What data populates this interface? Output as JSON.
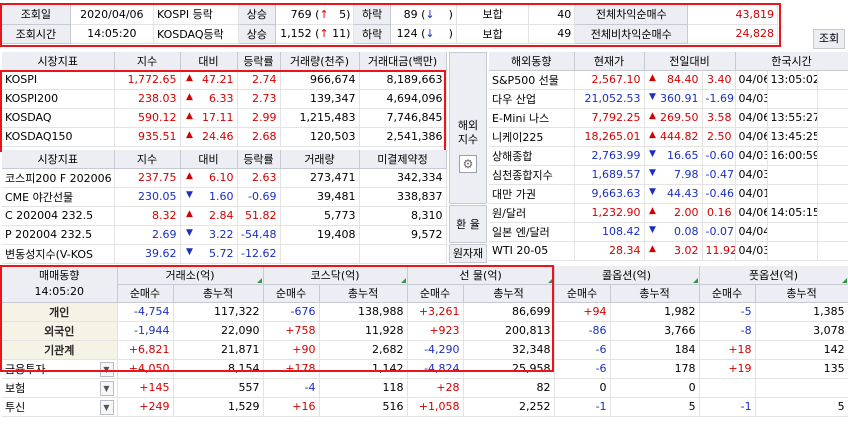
{
  "top": {
    "query_date_label": "조회일",
    "query_date": "2020/04/06",
    "query_time_label": "조회시간",
    "query_time": "14:05:20",
    "rows": [
      {
        "market": "KOSPI 등락",
        "up_label": "상승",
        "up_val": "769",
        "up_arrow": "↑",
        "up_limit": "5",
        "down_label": "하락",
        "down_val": "89",
        "down_arrow": "↓",
        "down_limit": "",
        "flat_label": "보합",
        "flat_val": "40",
        "net_label": "전체차익순매수",
        "net_val": "43,819"
      },
      {
        "market": "KOSDAQ등락",
        "up_label": "상승",
        "up_val": "1,152",
        "up_arrow": "↑",
        "up_limit": "11",
        "down_label": "하락",
        "down_val": "124",
        "down_arrow": "↓",
        "down_limit": "",
        "flat_label": "보합",
        "flat_val": "49",
        "net_label": "전체비차익순매수",
        "net_val": "24,828"
      }
    ],
    "query_button": "조회"
  },
  "index_table": {
    "headers": [
      "시장지표",
      "지수",
      "대비",
      "등락률",
      "거래량(천주)",
      "거래대금(백만)"
    ],
    "rows": [
      {
        "name": "KOSPI",
        "value": "1,772.65",
        "arrow": "▲",
        "change": "47.21",
        "rate": "2.74",
        "volume": "966,674",
        "amount": "8,189,663"
      },
      {
        "name": "KOSPI200",
        "value": "238.03",
        "arrow": "▲",
        "change": "6.33",
        "rate": "2.73",
        "volume": "139,347",
        "amount": "4,694,096"
      },
      {
        "name": "KOSDAQ",
        "value": "590.12",
        "arrow": "▲",
        "change": "17.11",
        "rate": "2.99",
        "volume": "1,215,483",
        "amount": "7,746,845"
      },
      {
        "name": "KOSDAQ150",
        "value": "935.51",
        "arrow": "▲",
        "change": "24.46",
        "rate": "2.68",
        "volume": "120,503",
        "amount": "2,541,386"
      }
    ]
  },
  "deriv_table": {
    "headers": [
      "시장지표",
      "지수",
      "대비",
      "등락률",
      "거래량",
      "미결제약정"
    ],
    "rows": [
      {
        "name": "코스피200 F 202006",
        "value": "237.75",
        "arrow": "▲",
        "change": "6.10",
        "rate": "2.63",
        "volume": "273,471",
        "oi": "342,334",
        "color": "red"
      },
      {
        "name": "CME 야간선물",
        "value": "230.05",
        "arrow": "▼",
        "change": "1.60",
        "rate": "-0.69",
        "volume": "39,481",
        "oi": "338,837",
        "color": "blue"
      },
      {
        "name": "C 202004 232.5",
        "value": "8.32",
        "arrow": "▲",
        "change": "2.84",
        "rate": "51.82",
        "volume": "5,773",
        "oi": "8,310",
        "color": "red"
      },
      {
        "name": "P 202004 232.5",
        "value": "2.69",
        "arrow": "▼",
        "change": "3.22",
        "rate": "-54.48",
        "volume": "19,408",
        "oi": "9,572",
        "color": "blue"
      },
      {
        "name": "변동성지수(V-KOS",
        "value": "39.62",
        "arrow": "▼",
        "change": "5.72",
        "rate": "-12.62",
        "volume": "",
        "oi": "",
        "color": "blue"
      }
    ]
  },
  "overseas": {
    "side_labels": {
      "overseas": "해외\n지수",
      "exchange": "환 율",
      "raw": "원자재"
    },
    "headers": [
      "해외동향",
      "현재가",
      "전일대비",
      "",
      "한국시간"
    ],
    "rows": [
      {
        "name": "S&P500 선물",
        "price": "2,567.10",
        "arrow": "▲",
        "change": "84.40",
        "rate": "3.40",
        "date": "04/06",
        "time": "13:05:02",
        "color": "red"
      },
      {
        "name": "다우 산업",
        "price": "21,052.53",
        "arrow": "▼",
        "change": "360.91",
        "rate": "-1.69",
        "date": "04/03",
        "time": "",
        "color": "blue"
      },
      {
        "name": "E-Mini 나스",
        "price": "7,792.25",
        "arrow": "▲",
        "change": "269.50",
        "rate": "3.58",
        "date": "04/06",
        "time": "13:55:27",
        "color": "red"
      },
      {
        "name": "니케이225",
        "price": "18,265.01",
        "arrow": "▲",
        "change": "444.82",
        "rate": "2.50",
        "date": "04/06",
        "time": "13:45:25",
        "color": "red"
      },
      {
        "name": "상해종합",
        "price": "2,763.99",
        "arrow": "▼",
        "change": "16.65",
        "rate": "-0.60",
        "date": "04/03",
        "time": "16:00:59",
        "color": "blue"
      },
      {
        "name": "심천종합지수",
        "price": "1,689.57",
        "arrow": "▼",
        "change": "7.98",
        "rate": "-0.47",
        "date": "04/03",
        "time": "",
        "color": "blue"
      },
      {
        "name": "대만 가권",
        "price": "9,663.63",
        "arrow": "▼",
        "change": "44.43",
        "rate": "-0.46",
        "date": "04/01",
        "time": "",
        "color": "blue"
      },
      {
        "name": "원/달러",
        "price": "1,232.90",
        "arrow": "▲",
        "change": "2.00",
        "rate": "0.16",
        "date": "04/06",
        "time": "14:05:15",
        "color": "red"
      },
      {
        "name": "일본 엔/달러",
        "price": "108.42",
        "arrow": "▼",
        "change": "0.08",
        "rate": "-0.07",
        "date": "04/04",
        "time": "",
        "color": "blue"
      },
      {
        "name": "WTI 20-05",
        "price": "28.34",
        "arrow": "▲",
        "change": "3.02",
        "rate": "11.92",
        "date": "04/03",
        "time": "",
        "color": "red"
      }
    ]
  },
  "investor": {
    "title": "매매동향",
    "time": "14:05:20",
    "groups": [
      "거래소(억)",
      "코스닥(억)",
      "선 물(억)",
      "콜옵션(억)",
      "풋옵션(억)"
    ],
    "sub": [
      "순매수",
      "총누적"
    ],
    "rows": [
      {
        "name": "개인",
        "dropdown": false,
        "vals": [
          "-4,754",
          "117,322",
          "-676",
          "138,988",
          "+3,261",
          "86,699",
          "+94",
          "1,982",
          "-5",
          "1,385"
        ]
      },
      {
        "name": "외국인",
        "dropdown": false,
        "vals": [
          "-1,944",
          "22,090",
          "+758",
          "11,928",
          "+923",
          "200,813",
          "-86",
          "3,766",
          "-8",
          "3,078"
        ]
      },
      {
        "name": "기관계",
        "dropdown": false,
        "vals": [
          "+6,821",
          "21,871",
          "+90",
          "2,682",
          "-4,290",
          "32,348",
          "-6",
          "184",
          "+18",
          "142"
        ]
      },
      {
        "name": "금융투자",
        "dropdown": true,
        "vals": [
          "+4,050",
          "8,154",
          "+178",
          "1,142",
          "-4,824",
          "25,958",
          "-6",
          "178",
          "+19",
          "135"
        ]
      },
      {
        "name": "보험",
        "dropdown": true,
        "vals": [
          "+145",
          "557",
          "-4",
          "118",
          "+28",
          "82",
          "0",
          "0",
          "",
          ""
        ]
      },
      {
        "name": "투신",
        "dropdown": true,
        "vals": [
          "+249",
          "1,529",
          "+16",
          "516",
          "+1,058",
          "2,252",
          "-1",
          "5",
          "-1",
          "5"
        ]
      }
    ]
  },
  "colors": {
    "up": "#d40000",
    "down": "#1a2fc0",
    "highlight": "#e8151b",
    "header_bg": "#edeef3"
  }
}
